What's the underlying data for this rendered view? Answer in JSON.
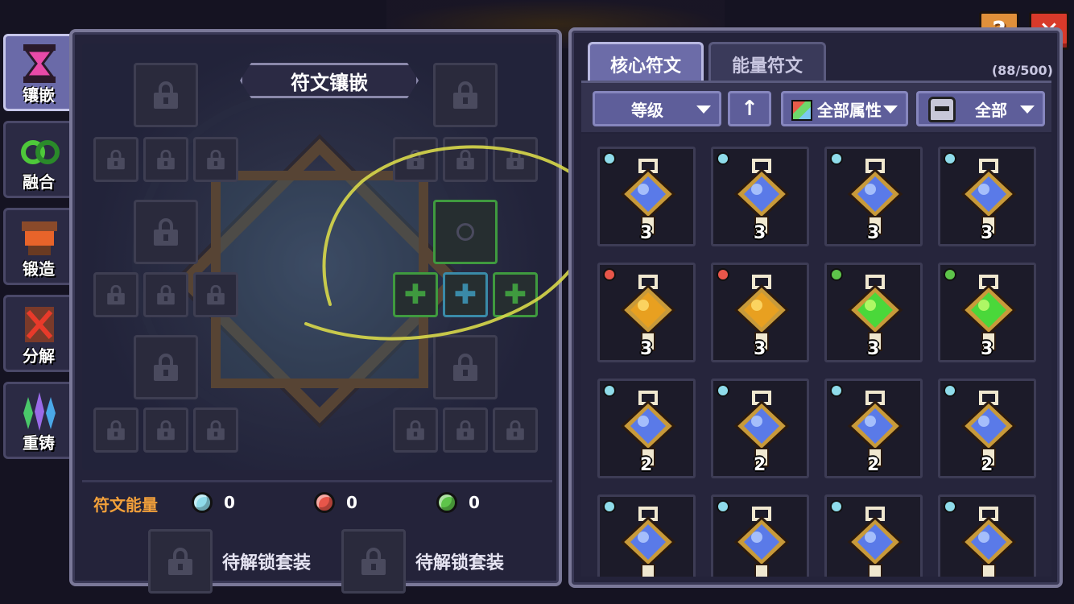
{
  "side_tabs": [
    {
      "label": "镶嵌",
      "icon": "hourglass-icon",
      "active": true
    },
    {
      "label": "融合",
      "icon": "fusion-icon",
      "active": false
    },
    {
      "label": "锻造",
      "icon": "anvil-icon",
      "active": false
    },
    {
      "label": "分解",
      "icon": "decompose-icon",
      "active": false
    },
    {
      "label": "重铸",
      "icon": "crystal-icon",
      "active": false
    }
  ],
  "board": {
    "title": "符文镶嵌"
  },
  "energy": {
    "label": "符文能量",
    "blue": "0",
    "red": "0",
    "green": "0"
  },
  "sets": [
    {
      "label": "待解锁套装"
    },
    {
      "label": "待解锁套装"
    }
  ],
  "buttons": {
    "help": "?",
    "close": "✕"
  },
  "tabs": {
    "core": "核心符文",
    "energy": "能量符文"
  },
  "inventory_count": "(88/500)",
  "filters": {
    "level": "等级",
    "sort": "↑",
    "attribute": "全部属性",
    "hero": "全部"
  },
  "runes": [
    {
      "gem": "blue",
      "level": "3"
    },
    {
      "gem": "blue",
      "level": "3"
    },
    {
      "gem": "blue",
      "level": "3"
    },
    {
      "gem": "blue",
      "level": "3"
    },
    {
      "gem": "red",
      "level": "3"
    },
    {
      "gem": "red",
      "level": "3"
    },
    {
      "gem": "green",
      "level": "3"
    },
    {
      "gem": "green",
      "level": "3"
    },
    {
      "gem": "blue",
      "level": "2"
    },
    {
      "gem": "blue",
      "level": "2"
    },
    {
      "gem": "blue",
      "level": "2"
    },
    {
      "gem": "blue",
      "level": "2"
    },
    {
      "gem": "blue",
      "level": ""
    },
    {
      "gem": "blue",
      "level": ""
    },
    {
      "gem": "blue",
      "level": ""
    },
    {
      "gem": "blue",
      "level": ""
    }
  ],
  "colors": {
    "accent_orange": "#f2a03a",
    "gem_blue": "#8fdcea",
    "gem_red": "#e8564a",
    "gem_green": "#5ec44a",
    "panel_bg": "#24233a"
  }
}
